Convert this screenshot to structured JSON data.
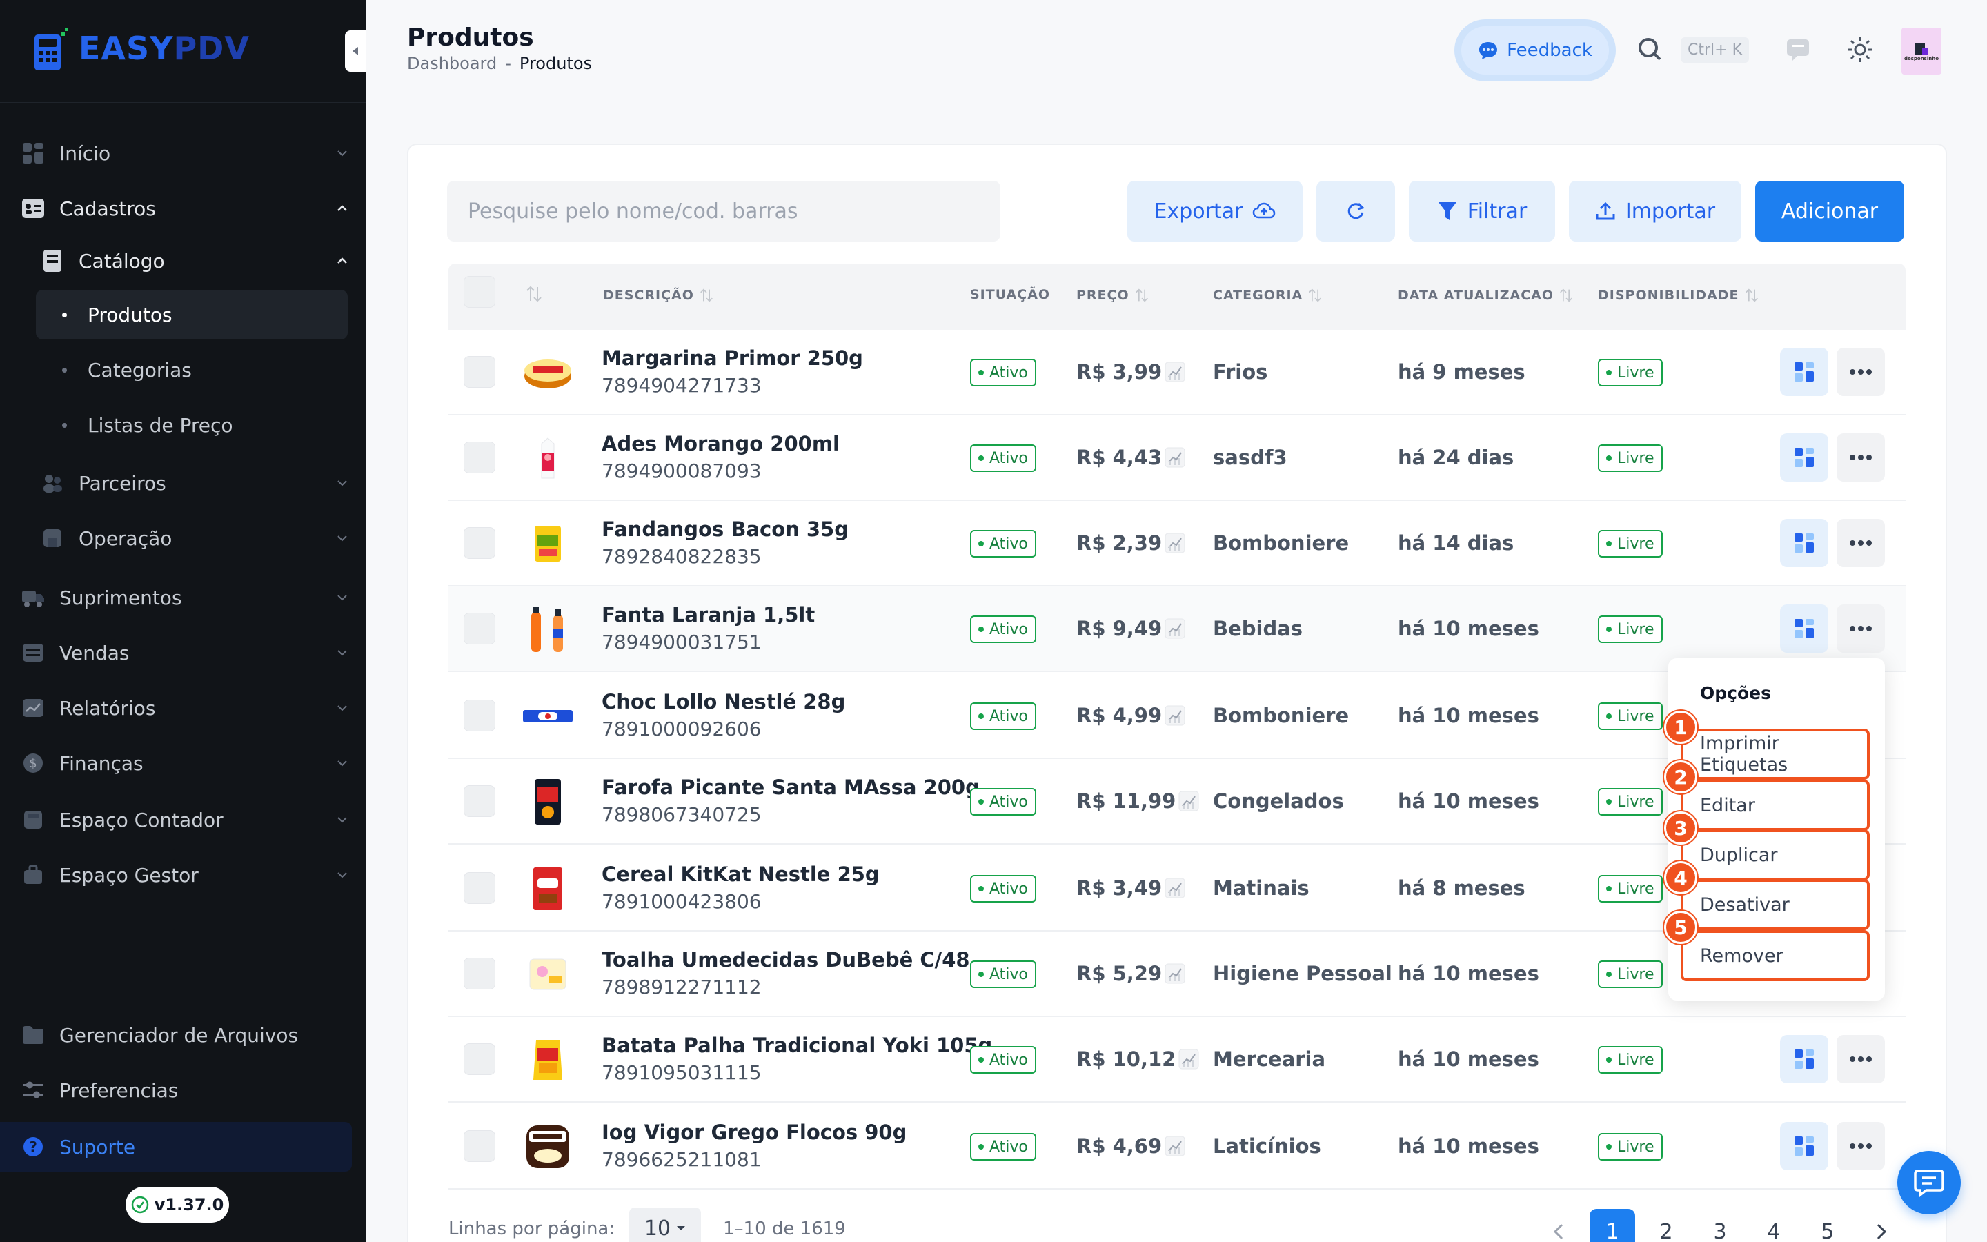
{
  "brand": {
    "name_part1": "EASY",
    "name_part2": "PDV"
  },
  "sidebar": {
    "items": [
      {
        "label": "Início",
        "icon": "dashboard-icon"
      },
      {
        "label": "Cadastros",
        "icon": "id-card-icon"
      },
      {
        "label": "Catálogo",
        "icon": "book-icon"
      },
      {
        "label": "Produtos"
      },
      {
        "label": "Categorias"
      },
      {
        "label": "Listas de Preço"
      },
      {
        "label": "Parceiros",
        "icon": "users-icon"
      },
      {
        "label": "Operação",
        "icon": "store-icon"
      },
      {
        "label": "Suprimentos",
        "icon": "truck-icon"
      },
      {
        "label": "Vendas",
        "icon": "cart-icon"
      },
      {
        "label": "Relatórios",
        "icon": "chart-icon"
      },
      {
        "label": "Finanças",
        "icon": "dollar-icon"
      },
      {
        "label": "Espaço Contador",
        "icon": "calculator-icon"
      },
      {
        "label": "Espaço Gestor",
        "icon": "briefcase-icon"
      },
      {
        "label": "Gerenciador de Arquivos",
        "icon": "folder-icon"
      },
      {
        "label": "Preferencias",
        "icon": "sliders-icon"
      },
      {
        "label": "Suporte",
        "icon": "help-icon"
      }
    ],
    "version": "v1.37.0"
  },
  "header": {
    "title": "Produtos",
    "breadcrumb": [
      "Dashboard",
      "-",
      "Produtos"
    ],
    "feedback_label": "Feedback",
    "shortcut": "Ctrl+ K",
    "avatar_text": "desponsinho"
  },
  "toolbar": {
    "search_placeholder": "Pesquise pelo nome/cod. barras",
    "export_label": "Exportar",
    "filter_label": "Filtrar",
    "import_label": "Importar",
    "add_label": "Adicionar"
  },
  "table": {
    "columns": [
      "DESCRIÇÃO",
      "SITUAÇÃO",
      "PREÇO",
      "CATEGORIA",
      "DATA ATUALIZACAO",
      "DISPONIBILIDADE"
    ],
    "rows": [
      {
        "name": "Margarina Primor 250g",
        "code": "7894904271733",
        "status": "Ativo",
        "price": "R$ 3,99",
        "category": "Frios",
        "updated": "há 9 meses",
        "availability": "Livre"
      },
      {
        "name": "Ades Morango 200ml",
        "code": "7894900087093",
        "status": "Ativo",
        "price": "R$ 4,43",
        "category": "sasdf3",
        "updated": "há 24 dias",
        "availability": "Livre"
      },
      {
        "name": "Fandangos Bacon 35g",
        "code": "7892840822835",
        "status": "Ativo",
        "price": "R$ 2,39",
        "category": "Bomboniere",
        "updated": "há 14 dias",
        "availability": "Livre"
      },
      {
        "name": "Fanta Laranja 1,5lt",
        "code": "7894900031751",
        "status": "Ativo",
        "price": "R$ 9,49",
        "category": "Bebidas",
        "updated": "há 10 meses",
        "availability": "Livre"
      },
      {
        "name": "Choc Lollo Nestlé 28g",
        "code": "7891000092606",
        "status": "Ativo",
        "price": "R$ 4,99",
        "category": "Bomboniere",
        "updated": "há 10 meses",
        "availability": "Livre"
      },
      {
        "name": "Farofa Picante Santa MAssa 200g",
        "code": "7898067340725",
        "status": "Ativo",
        "price": "R$ 11,99",
        "category": "Congelados",
        "updated": "há 10 meses",
        "availability": "Livre"
      },
      {
        "name": "Cereal KitKat Nestle 25g",
        "code": "7891000423806",
        "status": "Ativo",
        "price": "R$ 3,49",
        "category": "Matinais",
        "updated": "há 8 meses",
        "availability": "Livre"
      },
      {
        "name": "Toalha Umedecidas DuBebê C/48",
        "code": "7898912271112",
        "status": "Ativo",
        "price": "R$ 5,29",
        "category": "Higiene Pessoal",
        "updated": "há 10 meses",
        "availability": "Livre"
      },
      {
        "name": "Batata Palha Tradicional Yoki 105g",
        "code": "7891095031115",
        "status": "Ativo",
        "price": "R$ 10,12",
        "category": "Mercearia",
        "updated": "há 10 meses",
        "availability": "Livre"
      },
      {
        "name": "Iog Vigor Grego Flocos 90g",
        "code": "7896625211081",
        "status": "Ativo",
        "price": "R$ 4,69",
        "category": "Laticínios",
        "updated": "há 10 meses",
        "availability": "Livre"
      }
    ]
  },
  "menu": {
    "title": "Opções",
    "items": [
      "Imprimir Etiquetas",
      "Editar",
      "Duplicar",
      "Desativar",
      "Remover"
    ],
    "markers": [
      "1",
      "2",
      "3",
      "4",
      "5"
    ]
  },
  "footer": {
    "rows_label": "Linhas por página:",
    "rows_value": "10",
    "range": "1–10 de 1619",
    "pages": [
      "1",
      "2",
      "3",
      "4",
      "5"
    ]
  },
  "colors": {
    "accent": "#1d7ff0",
    "sidebar_bg": "#111418",
    "success": "#16a34a",
    "marker": "#f0521f"
  }
}
